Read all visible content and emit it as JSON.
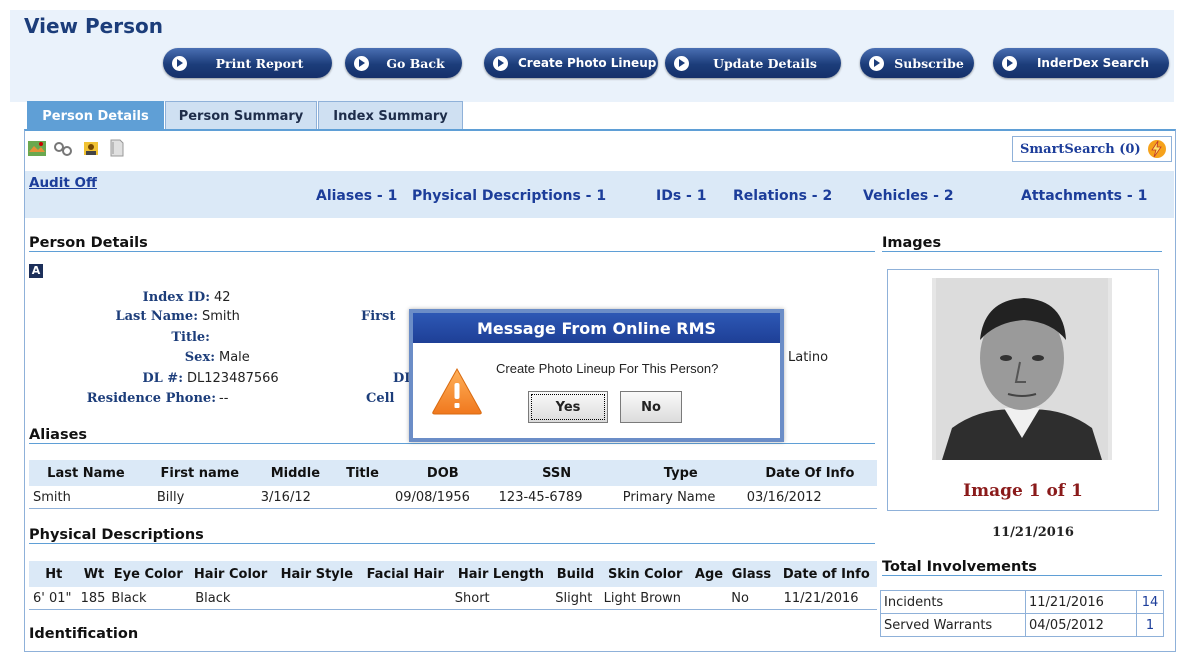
{
  "page_title": "View Person",
  "toolbar": {
    "print_report": "Print Report",
    "go_back": "Go Back",
    "create_photo_lineup": "Create Photo Lineup",
    "update_details": "Update Details",
    "subscribe": "Subscribe",
    "inderdex_search": "InderDex Search"
  },
  "tabs": {
    "person_details": "Person Details",
    "person_summary": "Person Summary",
    "index_summary": "Index Summary"
  },
  "smartsearch": "SmartSearch (0)",
  "audit": "Audit Off",
  "counts": {
    "aliases": "Aliases - 1",
    "physical": "Physical Descriptions - 1",
    "ids": "IDs - 1",
    "relations": "Relations - 2",
    "vehicles": "Vehicles - 2",
    "attachments": "Attachments - 1"
  },
  "details": {
    "header": "Person Details",
    "index_id_label": "Index ID:",
    "index_id": "42",
    "last_name_label": "Last Name:",
    "last_name": "Smith",
    "title_label": "Title:",
    "title": "",
    "sex_label": "Sex:",
    "sex": "Male",
    "dl_label": "DL #:",
    "dl": "DL123487566",
    "res_phone_label": "Residence Phone:",
    "res_phone": "--",
    "partial_first": "First",
    "partial_dl": "DL",
    "partial_cell": "Cell",
    "partial_ethnicity": "Latino"
  },
  "aliases": {
    "header": "Aliases",
    "columns": [
      "Last Name",
      "First name",
      "Middle",
      "Title",
      "DOB",
      "SSN",
      "Type",
      "Date Of Info"
    ],
    "rows": [
      [
        "Smith",
        "Billy",
        "3/16/12",
        "",
        "09/08/1956",
        "123-45-6789",
        "Primary Name",
        "03/16/2012"
      ]
    ]
  },
  "physical": {
    "header": "Physical Descriptions",
    "columns": [
      "Ht",
      "Wt",
      "Eye Color",
      "Hair Color",
      "Hair Style",
      "Facial Hair",
      "Hair Length",
      "Build",
      "Skin Color",
      "Age",
      "Glass",
      "Date of Info"
    ],
    "rows": [
      [
        "6' 01\"",
        "185",
        "Black",
        "Black",
        "",
        "",
        "Short",
        "Slight",
        "Light Brown",
        "",
        "No",
        "11/21/2016"
      ]
    ]
  },
  "identification_header": "Identification",
  "images": {
    "header": "Images",
    "counter": "Image 1 of 1",
    "date": "11/21/2016"
  },
  "involvements": {
    "header": "Total Involvements",
    "rows": [
      {
        "label": "Incidents",
        "date": "11/21/2016",
        "count": "14"
      },
      {
        "label": "Served Warrants",
        "date": "04/05/2012",
        "count": "1"
      }
    ]
  },
  "modal": {
    "title": "Message From Online RMS",
    "message": "Create Photo Lineup For This Person?",
    "yes": "Yes",
    "no": "No"
  },
  "colors": {
    "accent": "#1c3d7a",
    "tab_active": "#5f9fd6",
    "band": "#dbe9f7",
    "image_counter": "#8a1a1a"
  }
}
